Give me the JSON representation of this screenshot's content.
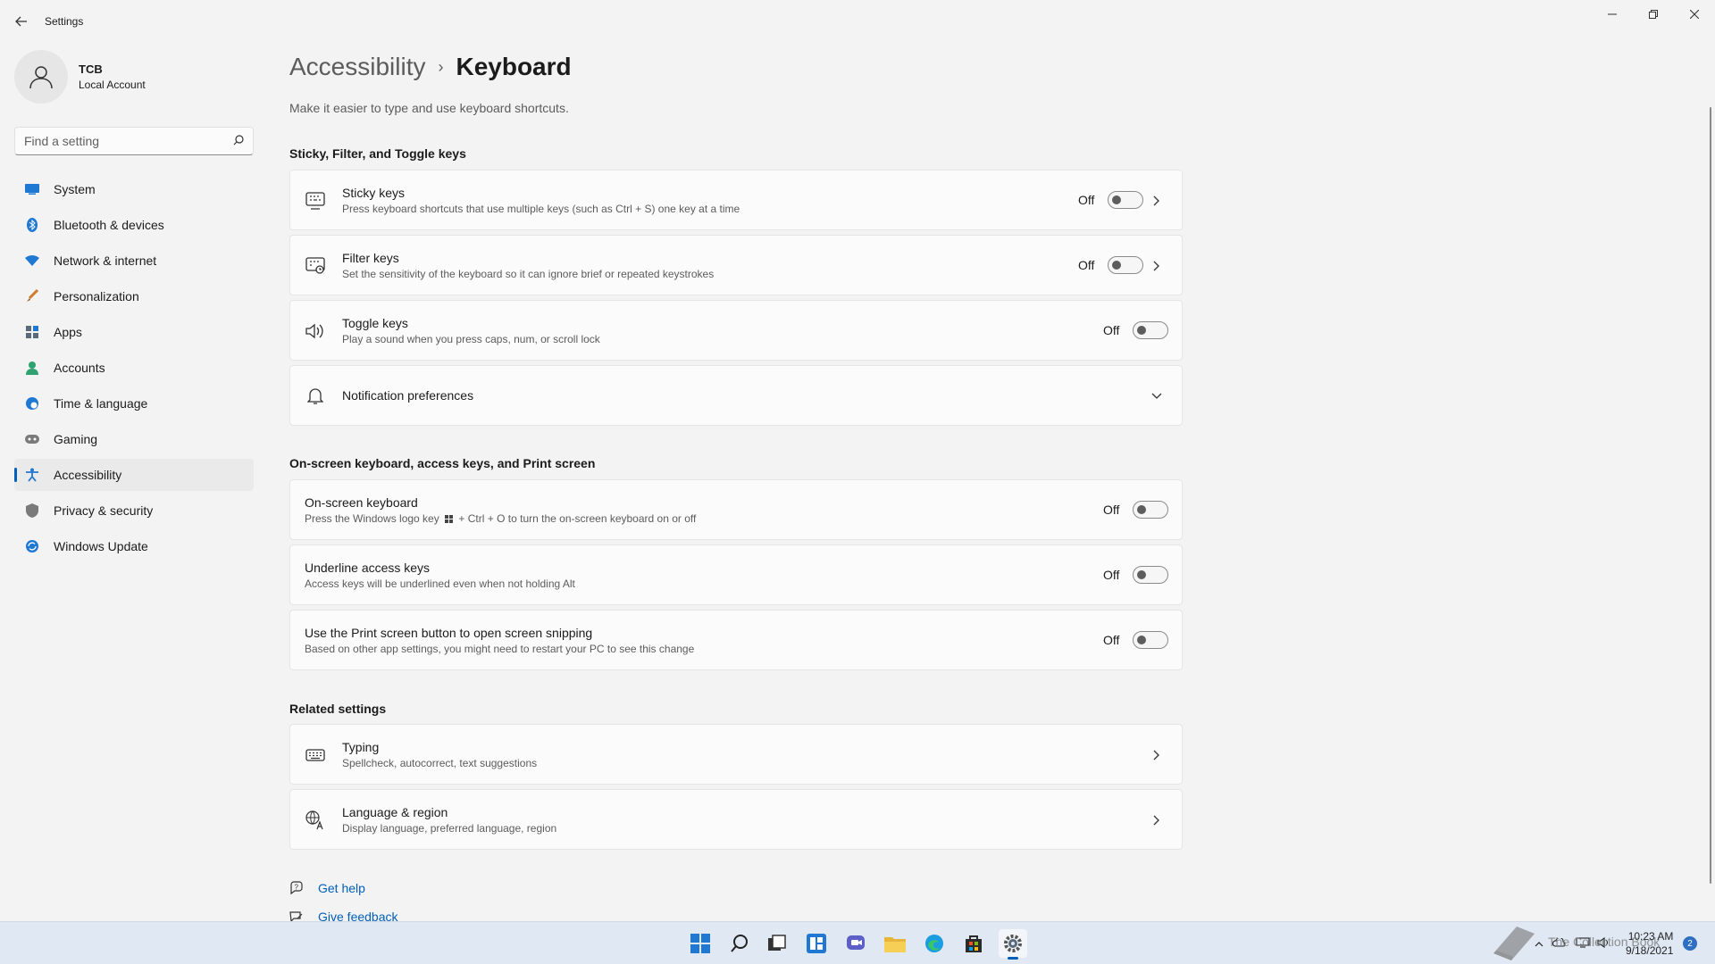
{
  "window": {
    "title": "Settings"
  },
  "profile": {
    "name": "TCB",
    "account_type": "Local Account"
  },
  "search": {
    "placeholder": "Find a setting"
  },
  "sidebar": {
    "items": [
      {
        "label": "System",
        "icon": "display-icon",
        "color": "#1f78d1"
      },
      {
        "label": "Bluetooth & devices",
        "icon": "bluetooth-icon",
        "color": "#1f78d1"
      },
      {
        "label": "Network & internet",
        "icon": "wifi-icon",
        "color": "#1f78d1"
      },
      {
        "label": "Personalization",
        "icon": "brush-icon",
        "color": "#d07a2e"
      },
      {
        "label": "Apps",
        "icon": "apps-icon",
        "color": "#5a6a7a"
      },
      {
        "label": "Accounts",
        "icon": "person-icon",
        "color": "#2ea36f"
      },
      {
        "label": "Time & language",
        "icon": "globe-clock-icon",
        "color": "#1f78d1"
      },
      {
        "label": "Gaming",
        "icon": "gamepad-icon",
        "color": "#7a7a7a"
      },
      {
        "label": "Accessibility",
        "icon": "accessibility-icon",
        "color": "#1f78d1",
        "active": true
      },
      {
        "label": "Privacy & security",
        "icon": "shield-icon",
        "color": "#7a7a7a"
      },
      {
        "label": "Windows Update",
        "icon": "update-icon",
        "color": "#1f78d1"
      }
    ]
  },
  "breadcrumb": {
    "parent": "Accessibility",
    "separator": "›",
    "current": "Keyboard"
  },
  "page": {
    "description": "Make it easier to type and use keyboard shortcuts."
  },
  "sections": {
    "sticky": {
      "title": "Sticky, Filter, and Toggle keys",
      "items": [
        {
          "title": "Sticky keys",
          "subtitle": "Press keyboard shortcuts that use multiple keys (such as Ctrl + S) one key at a time",
          "state": "Off",
          "icon": "sticky-keys-icon"
        },
        {
          "title": "Filter keys",
          "subtitle": "Set the sensitivity of the keyboard so it can ignore brief or repeated keystrokes",
          "state": "Off",
          "icon": "filter-keys-icon"
        },
        {
          "title": "Toggle keys",
          "subtitle": "Play a sound when you press caps, num, or scroll lock",
          "state": "Off",
          "icon": "speaker-icon"
        },
        {
          "title": "Notification preferences",
          "icon": "bell-icon"
        }
      ]
    },
    "onscreen": {
      "title": "On-screen keyboard, access keys, and Print screen",
      "items": [
        {
          "title": "On-screen keyboard",
          "subtitle_pre": "Press the Windows logo key",
          "subtitle_post": "+ Ctrl + O to turn the on-screen keyboard on or off",
          "state": "Off"
        },
        {
          "title": "Underline access keys",
          "subtitle": "Access keys will be underlined even when not holding Alt",
          "state": "Off"
        },
        {
          "title": "Use the Print screen button to open screen snipping",
          "subtitle": "Based on other app settings, you might need to restart your PC to see this change",
          "state": "Off"
        }
      ]
    },
    "related": {
      "title": "Related settings",
      "items": [
        {
          "title": "Typing",
          "subtitle": "Spellcheck, autocorrect, text suggestions",
          "icon": "keyboard-icon"
        },
        {
          "title": "Language & region",
          "subtitle": "Display language, preferred language, region",
          "icon": "language-icon"
        }
      ]
    }
  },
  "help": {
    "get_help": "Get help",
    "give_feedback": "Give feedback"
  },
  "taskbar": {
    "apps": [
      "start-icon",
      "search-icon",
      "task-view-icon",
      "widgets-icon",
      "chat-icon",
      "file-explorer-icon",
      "edge-icon",
      "store-icon",
      "settings-icon"
    ],
    "time": "10:23 AM",
    "date": "9/18/2021",
    "notification_count": "2",
    "watermark_text": "The Collection Book"
  },
  "colors": {
    "accent": "#005fb8",
    "background": "#f3f3f3",
    "card": "#fbfbfb"
  }
}
